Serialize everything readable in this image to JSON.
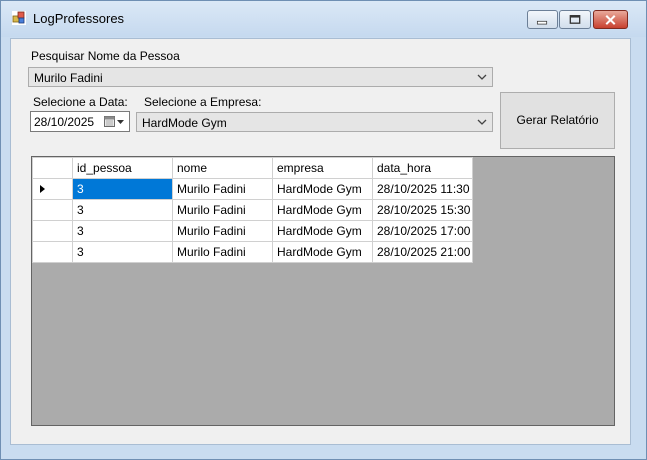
{
  "window": {
    "title": "LogProfessores"
  },
  "search": {
    "label": "Pesquisar Nome da Pessoa",
    "value": "Murilo Fadini"
  },
  "date": {
    "label": "Selecione a Data:",
    "value": "28/10/2025"
  },
  "company": {
    "label": "Selecione a Empresa:",
    "value": "HardMode Gym"
  },
  "report_button": {
    "label": "Gerar Relatório"
  },
  "grid": {
    "columns": [
      "id_pessoa",
      "nome",
      "empresa",
      "data_hora"
    ],
    "rows": [
      [
        "3",
        "Murilo Fadini",
        "HardMode Gym",
        "28/10/2025 11:30"
      ],
      [
        "3",
        "Murilo Fadini",
        "HardMode Gym",
        "28/10/2025 15:30"
      ],
      [
        "3",
        "Murilo Fadini",
        "HardMode Gym",
        "28/10/2025 17:00"
      ],
      [
        "3",
        "Murilo Fadini",
        "HardMode Gym",
        "28/10/2025 21:00"
      ]
    ]
  },
  "colors": {
    "selection": "#0078d7",
    "grid_background": "#ababab",
    "close_button": "#c8412f"
  },
  "icons": [
    "app-icon",
    "minimize-icon",
    "maximize-icon",
    "close-icon",
    "calendar-icon",
    "chevron-down-icon",
    "row-pointer-icon"
  ]
}
